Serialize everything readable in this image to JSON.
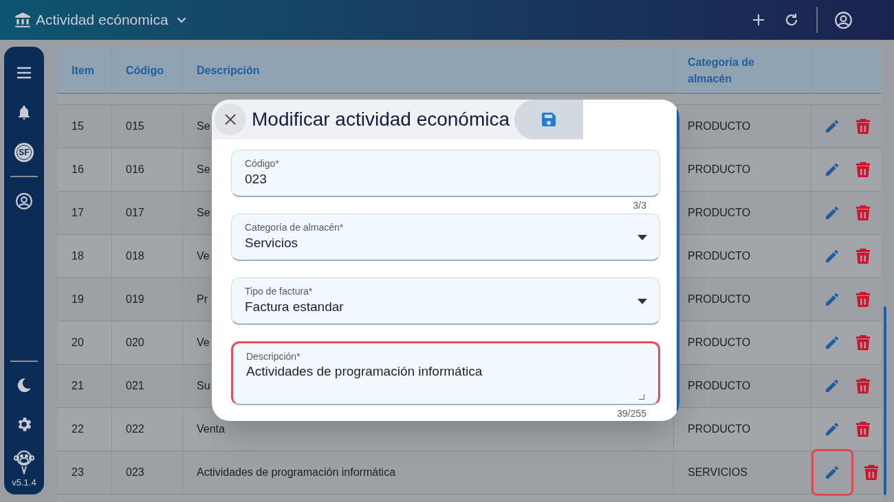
{
  "app_bar": {
    "title": "Actividad ecónomica"
  },
  "sidebar": {
    "badge": "SF",
    "version": "v5.1.4"
  },
  "table": {
    "columns": [
      "Item",
      "Código",
      "Descripción",
      "Categoría de almacén"
    ],
    "rows": [
      {
        "item": "15",
        "code": "015",
        "description": "Se",
        "category": "PRODUCTO",
        "edit_highlighted": false
      },
      {
        "item": "16",
        "code": "016",
        "description": "Se",
        "category": "PRODUCTO",
        "edit_highlighted": false
      },
      {
        "item": "17",
        "code": "017",
        "description": "Se",
        "category": "PRODUCTO",
        "edit_highlighted": false
      },
      {
        "item": "18",
        "code": "018",
        "description": "Ve",
        "category": "PRODUCTO",
        "edit_highlighted": false
      },
      {
        "item": "19",
        "code": "019",
        "description": "Pr",
        "category": "PRODUCTO",
        "edit_highlighted": false
      },
      {
        "item": "20",
        "code": "020",
        "description": "Ve",
        "category": "PRODUCTO",
        "edit_highlighted": false
      },
      {
        "item": "21",
        "code": "021",
        "description": "Su",
        "category": "PRODUCTO",
        "edit_highlighted": false
      },
      {
        "item": "22",
        "code": "022",
        "description": "Venta",
        "category": "PRODUCTO",
        "edit_highlighted": false
      },
      {
        "item": "23",
        "code": "023",
        "description": "Actividades de programación informática",
        "category": "SERVICIOS",
        "edit_highlighted": true
      }
    ]
  },
  "dialog": {
    "title": "Modificar actividad económica",
    "fields": [
      {
        "kind": "text",
        "label": "Código*",
        "value": "023",
        "counter": "3/3",
        "highlighted": false
      },
      {
        "kind": "select",
        "label": "Categoría de almacén*",
        "value": "Servicios",
        "highlighted": false
      },
      {
        "kind": "select",
        "label": "Tipo de factura*",
        "value": "Factura estandar",
        "highlighted": false
      },
      {
        "kind": "textarea",
        "label": "Descripción*",
        "value": "Actividades de programación informática",
        "counter": "39/255",
        "highlighted": true
      }
    ]
  }
}
